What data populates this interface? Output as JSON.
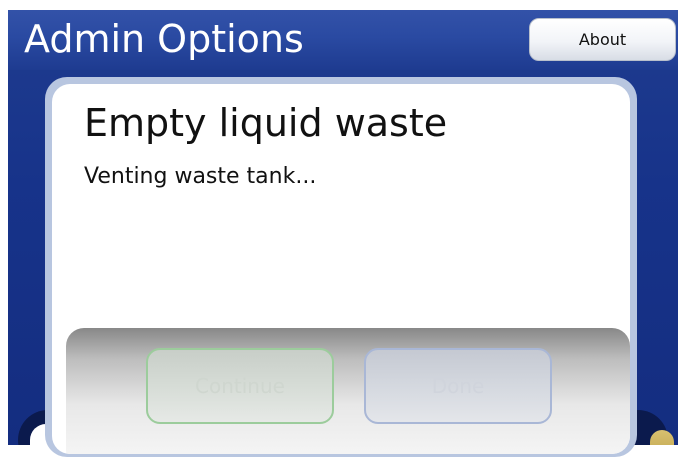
{
  "header": {
    "title": "Admin Options",
    "about_label": "About"
  },
  "dialog": {
    "title": "Empty liquid waste",
    "message": "Venting waste tank...",
    "continue_label": "Continue",
    "done_label": "Done"
  },
  "colors": {
    "header_blue": "#2a4aa2",
    "background_blue": "#17338a",
    "dialog_border": "#b8c6e0",
    "continue_border": "#9ccc9c",
    "done_border": "#a9b7d6"
  }
}
